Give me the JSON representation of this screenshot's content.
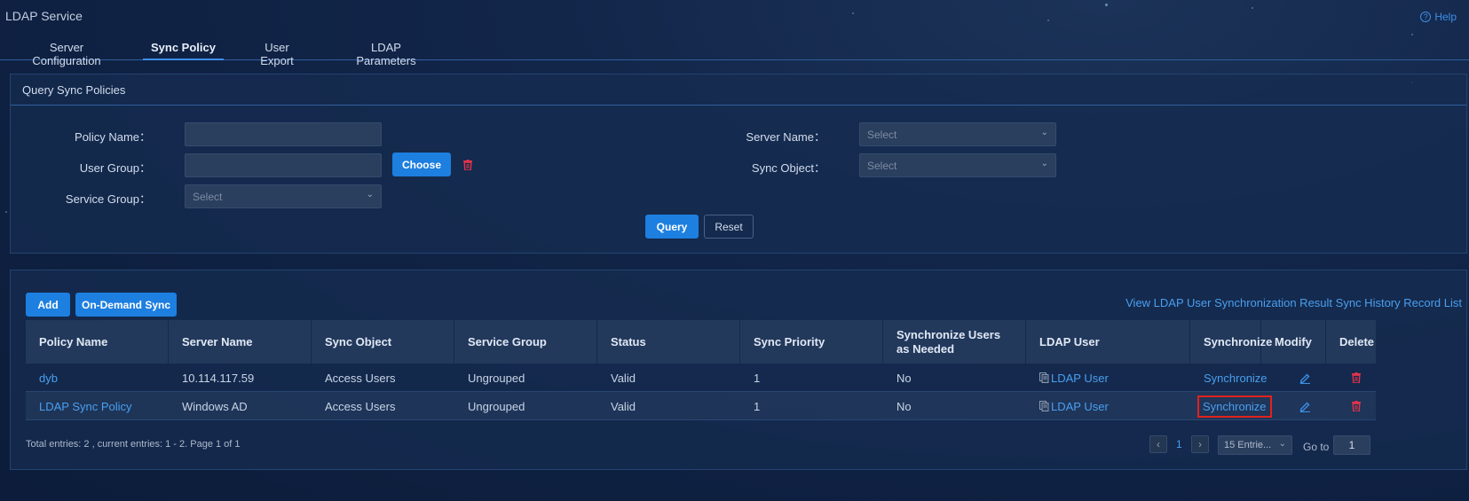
{
  "app": {
    "title": "LDAP Service",
    "help_label": "Help"
  },
  "tabs": [
    {
      "label": "Server Configuration",
      "active": false
    },
    {
      "label": "Sync Policy",
      "active": true
    },
    {
      "label": "User Export",
      "active": false
    },
    {
      "label": "LDAP Parameters",
      "active": false
    }
  ],
  "query": {
    "title": "Query Sync Policies",
    "policy_name_label": "Policy Name：",
    "policy_name_value": "",
    "user_group_label": "User Group：",
    "user_group_value": "",
    "choose_label": "Choose",
    "service_group_label": "Service Group：",
    "service_group_placeholder": "Select",
    "server_name_label": "Server Name：",
    "server_name_placeholder": "Select",
    "sync_object_label": "Sync Object：",
    "sync_object_placeholder": "Select",
    "query_label": "Query",
    "reset_label": "Reset"
  },
  "list": {
    "add_label": "Add",
    "on_demand_sync_label": "On-Demand Sync",
    "view_result_link": "View LDAP User Synchronization Result",
    "history_link": "Sync History Record List",
    "columns": {
      "policy_name": "Policy Name",
      "server_name": "Server Name",
      "sync_object": "Sync Object",
      "service_group": "Service Group",
      "status": "Status",
      "sync_priority": "Sync Priority",
      "sync_as_needed": "Synchronize Users as Needed",
      "ldap_user": "LDAP User",
      "synchronize": "Synchronize",
      "modify": "Modify",
      "delete": "Delete"
    },
    "rows": [
      {
        "policy_name": "dyb",
        "server_name": "10.114.117.59",
        "sync_object": "Access Users",
        "service_group": "Ungrouped",
        "status": "Valid",
        "sync_priority": "1",
        "sync_as_needed": "No",
        "ldap_user": "LDAP User",
        "synchronize": "Synchronize"
      },
      {
        "policy_name": "LDAP Sync Policy",
        "server_name": "Windows AD",
        "sync_object": "Access Users",
        "service_group": "Ungrouped",
        "status": "Valid",
        "sync_priority": "1",
        "sync_as_needed": "No",
        "ldap_user": "LDAP User",
        "synchronize": "Synchronize"
      }
    ],
    "footer": {
      "summary": "Total entries: 2 , current entries: 1 - 2. Page 1 of 1",
      "current_page": "1",
      "page_size": "15 Entrie...",
      "goto_label": "Go to",
      "goto_value": "1"
    }
  },
  "colors": {
    "accent": "#1d7fe0",
    "link": "#4a9ff0",
    "danger": "#e0334a",
    "highlight": "#e0221b"
  }
}
